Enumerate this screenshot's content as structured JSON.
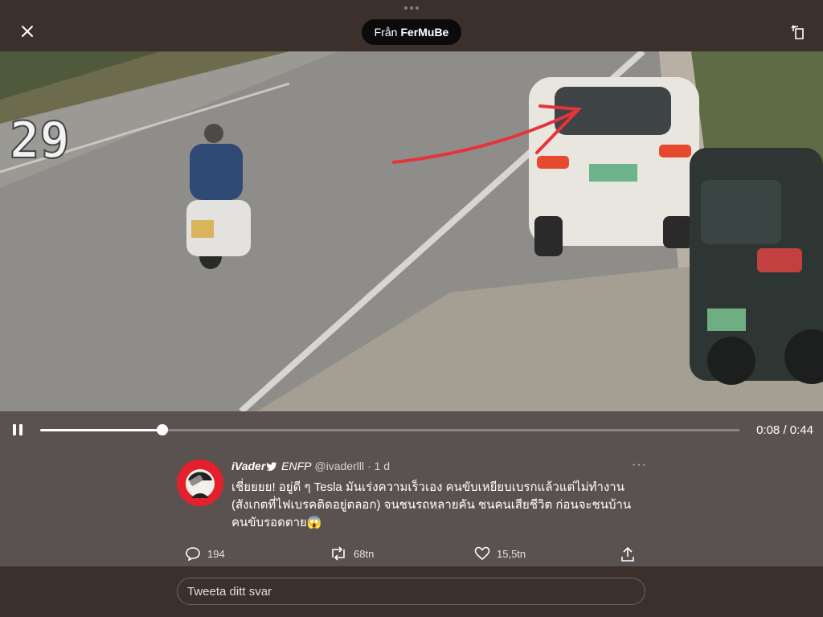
{
  "header": {
    "source_prefix": "Från",
    "source_account": "FerMuBe",
    "icons": [
      "close-icon",
      "rotate-screen-icon"
    ]
  },
  "video": {
    "timestamp_overlay": "29",
    "elapsed": "0:08",
    "duration": "0:44",
    "progress_fraction": 0.175,
    "playing": true
  },
  "tweet": {
    "display_name": "iVader",
    "flair": "ENFP",
    "handle": "@ivaderlll",
    "age": "· 1 d",
    "text_lines": [
      "เชี่ยยยย! อยู่ดี ๆ Tesla มันเร่งความเร็วเอง คนขับเหยียบเบรกแล้วแต่ไม่ทำงาน",
      "(สังเกตที่ไฟเบรคติดอยู่ตลอก) จนชนรถหลายคัน ชนคนเสียชีวิต ก่อนจะชนบ้าน",
      "คนขับรอดตาย😱"
    ],
    "replies": "194",
    "retweets": "68tn",
    "likes": "15,5tn",
    "more": "···"
  },
  "reply": {
    "placeholder": "Tweeta ditt svar"
  },
  "colors": {
    "background": "#3b302c",
    "panel": "#5a5250",
    "annotation_red": "#e8333b",
    "avatar_red": "#e3202c"
  }
}
